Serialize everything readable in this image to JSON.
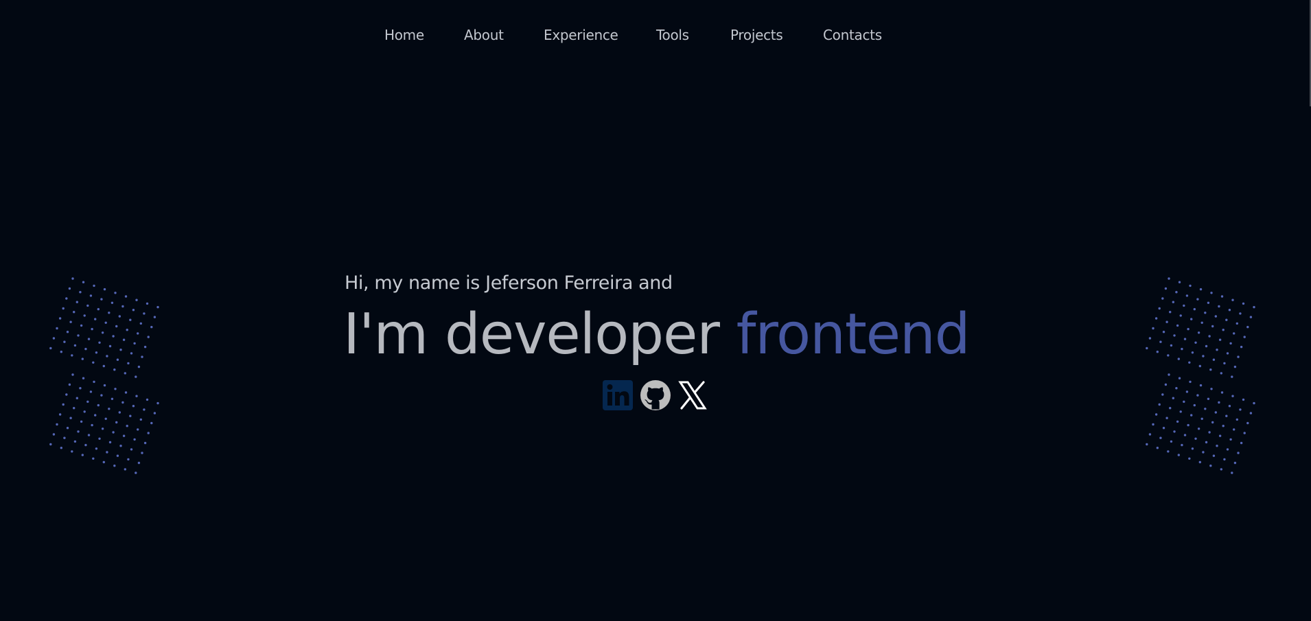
{
  "colors": {
    "background": "#020812",
    "nav_text": "#c3c7cf",
    "title_text": "#b6b9bf",
    "accent": "#4657a0",
    "dot_pattern": "#5567b7",
    "linkedin_bg": "#05274f",
    "github_icon": "#bdbdbd",
    "x_icon": "#ffffff"
  },
  "nav": {
    "items": [
      {
        "label": "Home"
      },
      {
        "label": "About"
      },
      {
        "label": "Experience"
      },
      {
        "label": "Tools"
      },
      {
        "label": "Projects"
      },
      {
        "label": "Contacts"
      }
    ]
  },
  "hero": {
    "greeting": "Hi, my name is Jeferson Ferreira and",
    "title_plain": "I'm developer",
    "title_accent": "frontend"
  },
  "social": {
    "links": [
      {
        "icon": "linkedin-icon"
      },
      {
        "icon": "github-icon"
      },
      {
        "icon": "x-twitter-icon"
      }
    ]
  },
  "decor": {
    "icon": "dot-grid-pattern"
  }
}
